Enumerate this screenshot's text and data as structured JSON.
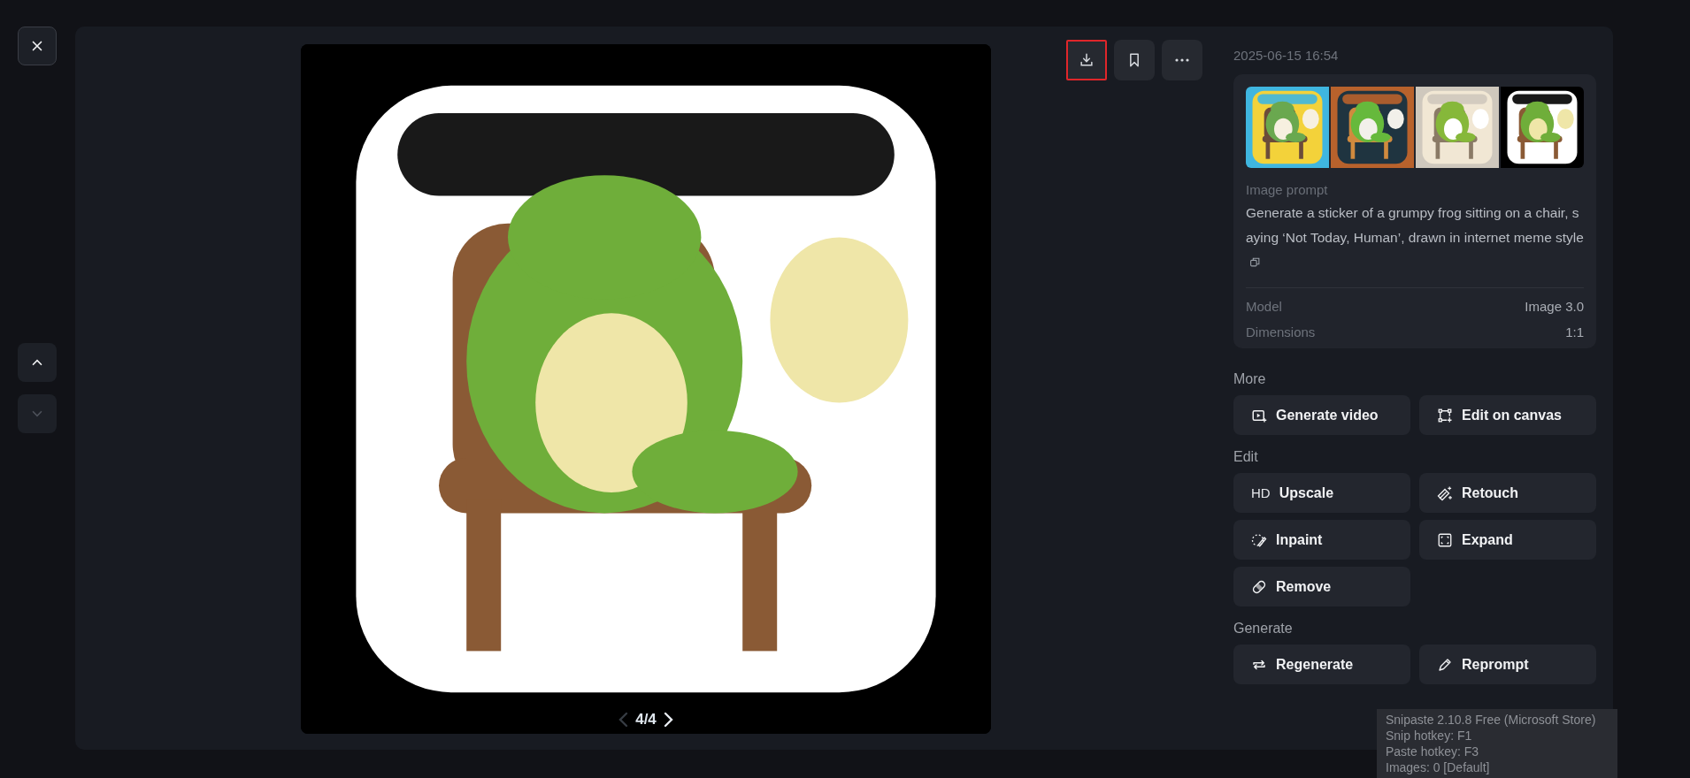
{
  "nav": {
    "close": {
      "kind": "close"
    },
    "up": {
      "disabled": false
    },
    "down": {
      "disabled": true
    }
  },
  "viewer": {
    "kind": "picture",
    "pager": {
      "text": "4/4",
      "prev_disabled": true,
      "next_disabled": false
    }
  },
  "toolbar": [
    {
      "kind": "download",
      "highlighted": true
    },
    {
      "kind": "bookmark",
      "highlighted": false
    },
    {
      "kind": "more",
      "highlighted": false
    }
  ],
  "details": {
    "timestamp": "2025-06-15 16:54",
    "prompt_label": "Image prompt",
    "prompt": "Generate a sticker of a grumpy frog sitting on a chair, saying ‘Not Today, Human’, drawn in internet meme style",
    "properties": [
      {
        "label": "Model",
        "value": "Image 3.0"
      },
      {
        "label": "Dimensions",
        "value": "1:1"
      }
    ]
  },
  "sections": [
    {
      "title": "More",
      "buttons": [
        {
          "kind": "video",
          "label": "Generate video"
        },
        {
          "kind": "canvas",
          "label": "Edit on canvas"
        }
      ]
    },
    {
      "title": "Edit",
      "buttons": [
        {
          "kind": "upscale",
          "icon_text": "HD",
          "label": "Upscale"
        },
        {
          "kind": "retouch",
          "label": "Retouch"
        },
        {
          "kind": "inpaint",
          "label": "Inpaint"
        },
        {
          "kind": "expand",
          "label": "Expand"
        },
        {
          "kind": "remove",
          "label": "Remove"
        }
      ]
    },
    {
      "title": "Generate",
      "buttons": [
        {
          "kind": "regenerate",
          "label": "Regenerate"
        },
        {
          "kind": "reprompt",
          "label": "Reprompt"
        }
      ]
    }
  ],
  "tooltip": {
    "lines": [
      "Snipaste 2.10.8 Free (Microsoft Store)",
      "Snip hotkey: F1",
      "Paste hotkey: F3",
      "Images: 0 [Default]"
    ]
  }
}
